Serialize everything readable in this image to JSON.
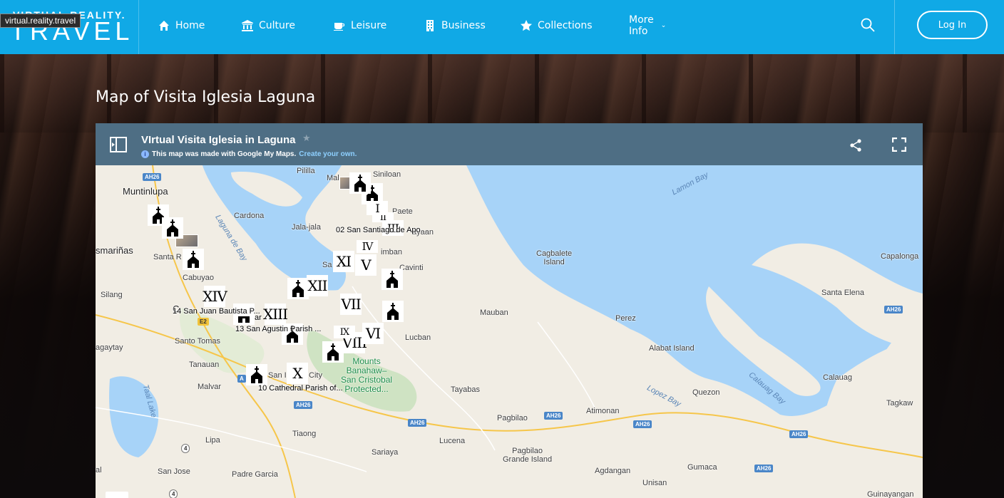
{
  "browser": {
    "url_tooltip": "virtual.reality.travel"
  },
  "header": {
    "logo_top": "VIRTUAL REALITY.",
    "logo_main": "TRAVEL",
    "nav": [
      {
        "label": "Home",
        "icon": "home-icon"
      },
      {
        "label": "Culture",
        "icon": "institution-icon"
      },
      {
        "label": "Leisure",
        "icon": "coffee-cup-icon"
      },
      {
        "label": "Business",
        "icon": "building-icon"
      },
      {
        "label": "Collections",
        "icon": "star-icon"
      },
      {
        "label": "More Info",
        "icon": "chevron-down-icon"
      }
    ],
    "login_label": "Log In"
  },
  "page": {
    "title": "Map of Visita Iglesia Laguna"
  },
  "map": {
    "title": "VIrtual Visita Iglesia in Laguna",
    "made_with": "This map was made with Google My Maps.",
    "create_link": "Create your own.",
    "places": {
      "muntinlupa": "Muntinlupa",
      "cardona": "Cardona",
      "jalajala": "Jala-jala",
      "pililla": "Pililla",
      "siniloan": "Siniloan",
      "paete": "Paete",
      "mal": "Mal",
      "dasmarinas": "smariñas",
      "santa_rosa": "Santa R",
      "cabuyao": "Cabuyao",
      "silang": "Silang",
      "calamba": "C",
      "tagaytay": "agaytay",
      "santo_tomas": "Santo Tomas",
      "tanauan": "Tanauan",
      "malvar": "Malvar",
      "lipa": "Lipa",
      "san_jose": "San Jose",
      "padre_garcia": "Padre Garcia",
      "tiaong": "Tiaong",
      "sariaya": "Sariaya",
      "lucena": "Lucena",
      "pagbilao": "Pagbilao",
      "pagbilao_grande": "Pagbilao\nGrande Island",
      "tayabas": "Tayabas",
      "mauban": "Mauban",
      "lucban": "Lucban",
      "cavinti": "Cavinti",
      "lumban": "imban",
      "kalayaan": "ayaan",
      "sa": "Sa",
      "san_pablo": "San I",
      "city": "City",
      "cagbalete": "Cagbalete\nIsland",
      "perez": "Perez",
      "alabat": "Alabat Island",
      "quezon": "Quezon",
      "atimonan": "Atimonan",
      "gumaca": "Gumaca",
      "unisan": "Unisan",
      "agdangan": "Agdangan",
      "calauag": "Calauag",
      "tagkawayan": "Tagkaw",
      "capalonga": "Capalonga",
      "santa_elena": "Santa Elena",
      "guinayangan": "Guinayangan",
      "mal_bottom": "al",
      "banahaw": "Mounts\nBanahaw–\nSan Cristobal\nProtected..."
    },
    "water": {
      "laguna_de_bay": "Laguna de Bay",
      "lamon_bay": "Lamon Bay",
      "lopez_bay": "Lopez Bay",
      "calauag_bay": "Calauag Bay",
      "taal_lake": "Taal Lake"
    },
    "routes": {
      "ah26": "AH26",
      "e2": "E2",
      "r4": "4",
      "a": "A"
    },
    "pin_labels": {
      "p02": "02 San Santiago de Apo...",
      "p14": "14 San Juan Bautista P...",
      "p13": "13 San Agustin Parish ...",
      "p10": "10 Cathedral Parish of...",
      "ar": "ar"
    },
    "numerals": [
      "XIV",
      "XIII",
      "XII",
      "XI",
      "X",
      "VIII",
      "VII",
      "VI",
      "V",
      "IV",
      "III",
      "II",
      "I",
      "IX"
    ]
  }
}
